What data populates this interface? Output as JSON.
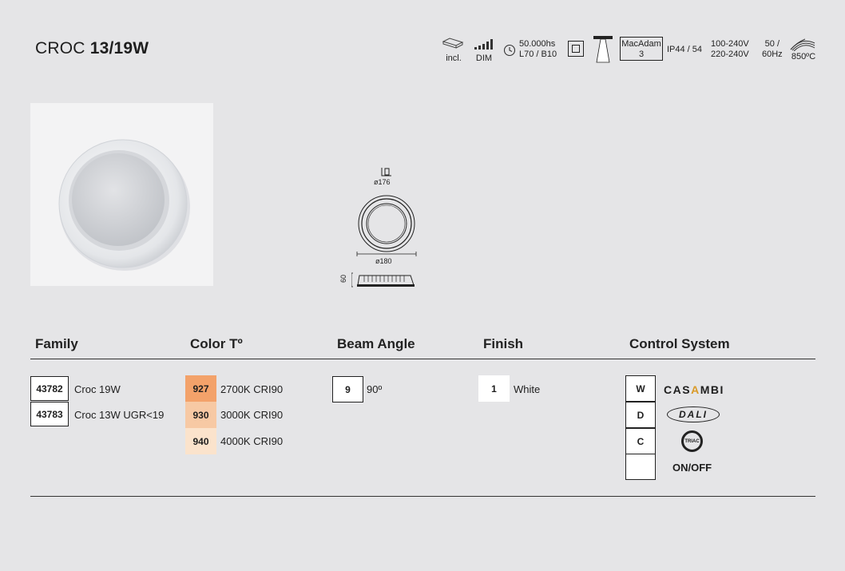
{
  "product": {
    "name_light": "CROC",
    "name_bold": "13/19W"
  },
  "specs": {
    "driver": "incl.",
    "dimming": "DIM",
    "lifetime_hours": "50.000hs",
    "lifetime_rating": "L70 / B10",
    "macadam_label": "MacAdam",
    "macadam_value": "3",
    "ip_rating": "IP44 / 54",
    "voltage_1": "100-240V",
    "voltage_2": "220-240V",
    "frequency_1": "50 /",
    "frequency_2": "60Hz",
    "glow_wire": "850ºC"
  },
  "dimensions": {
    "cutout": "ø176",
    "diameter": "ø180",
    "height": "60"
  },
  "table": {
    "headers": {
      "family": "Family",
      "color": "Color Tº",
      "beam": "Beam Angle",
      "finish": "Finish",
      "control": "Control System"
    },
    "family": [
      {
        "code": "43782",
        "name": "Croc 19W"
      },
      {
        "code": "43783",
        "name": "Croc 13W UGR<19"
      }
    ],
    "color": [
      {
        "code": "927",
        "label": "2700K CRI90",
        "swatch": "#f3a26a"
      },
      {
        "code": "930",
        "label": "3000K CRI90",
        "swatch": "#f7c9a4"
      },
      {
        "code": "940",
        "label": "4000K CRI90",
        "swatch": "#fbe3cc"
      }
    ],
    "beam": {
      "code": "9",
      "label": "90º"
    },
    "finish": {
      "code": "1",
      "label": "White"
    },
    "control": [
      {
        "code": "W",
        "logo": "CASAMBI"
      },
      {
        "code": "D",
        "logo": "DALI"
      },
      {
        "code": "C",
        "logo": "TRIAC"
      },
      {
        "code": "",
        "logo": "ON/OFF"
      }
    ]
  },
  "colors": {
    "accent_casambi": "#d99a28",
    "rule": "#333333"
  }
}
